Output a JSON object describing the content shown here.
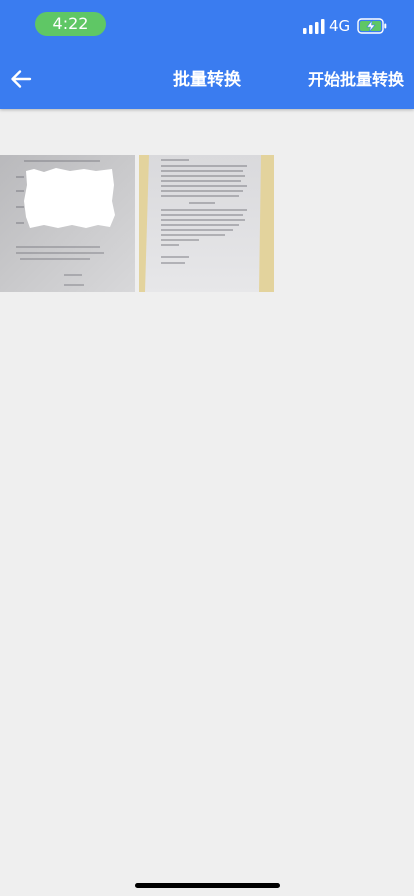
{
  "status_bar": {
    "time": "4:22",
    "network": "4G",
    "battery_charging": true,
    "pill_color": "#5fc765"
  },
  "header": {
    "back_icon": "arrow-left-icon",
    "title": "批量转换",
    "action_label": "开始批量转换",
    "background": "#3a7cf0"
  },
  "images": [
    {
      "name": "document-photo-1"
    },
    {
      "name": "document-photo-2"
    }
  ]
}
